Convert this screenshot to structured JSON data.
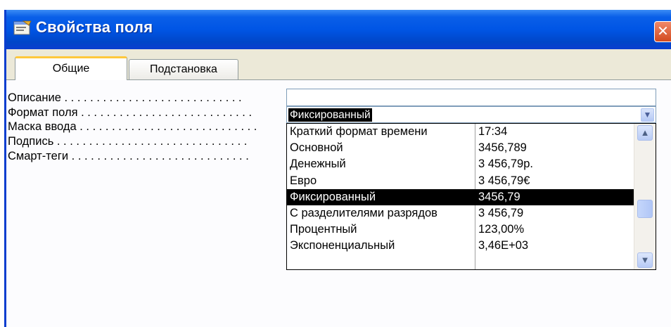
{
  "window": {
    "title": "Свойства поля",
    "close_label": "✕"
  },
  "tabs": [
    {
      "label": "Общие",
      "active": true
    },
    {
      "label": "Подстановка",
      "active": false
    }
  ],
  "properties": [
    {
      "label": "Описание . . . . . . . . . . . . . . . . . . . . . . . . . . . ."
    },
    {
      "label": "Формат поля . . . . . . . . . . . . . . . . . . . . . . . . . . ."
    },
    {
      "label": "Маска ввода . . . . . . . . . . . . . . . . . . . . . . . . . . . ."
    },
    {
      "label": "Подпись . . . . . . . . . . . . . . . . . . . . . . . . . . . . . ."
    },
    {
      "label": "Смарт-теги . . . . . . . . . . . . . . . . . . . . . . . . . . . ."
    }
  ],
  "format_field": {
    "value": "Фиксированный",
    "dropdown_arrow": "▼"
  },
  "format_options": [
    {
      "name": "Краткий формат времени",
      "example": "17:34"
    },
    {
      "name": "Основной",
      "example": "3456,789"
    },
    {
      "name": "Денежный",
      "example": "3 456,79р."
    },
    {
      "name": "Евро",
      "example": "3 456,79€"
    },
    {
      "name": "Фиксированный",
      "example": "3456,79",
      "selected": true
    },
    {
      "name": "С разделителями разрядов",
      "example": "3 456,79"
    },
    {
      "name": "Процентный",
      "example": "123,00%"
    },
    {
      "name": "Экспоненциальный",
      "example": "3,46E+03"
    }
  ],
  "scrollbar": {
    "up_arrow": "▲",
    "down_arrow": "▼"
  },
  "colors": {
    "titlebar": "#0055e5",
    "selection": "#000000",
    "tab_highlight": "#ffc83c"
  }
}
